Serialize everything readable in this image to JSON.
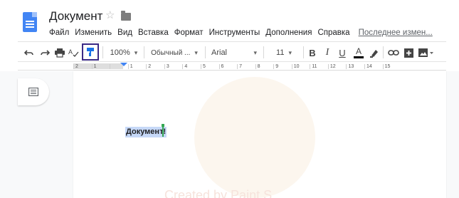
{
  "document": {
    "title": "Документ",
    "body_text": "Документ!"
  },
  "menu": {
    "items": [
      "Файл",
      "Изменить",
      "Вид",
      "Вставка",
      "Формат",
      "Инструменты",
      "Дополнения",
      "Справка"
    ],
    "last_edit": "Последнее измен..."
  },
  "toolbar": {
    "zoom": "100%",
    "style": "Обычный ...",
    "font": "Arial",
    "font_size": "11",
    "icons": [
      "undo-icon",
      "redo-icon",
      "print-icon",
      "spellcheck-icon",
      "paint-format-icon",
      "bold-icon",
      "italic-icon",
      "underline-icon",
      "text-color-icon",
      "highlight-icon",
      "link-icon",
      "comment-icon",
      "image-icon"
    ]
  },
  "ruler": {
    "labels": [
      "2",
      "1",
      "",
      "1",
      "2",
      "3",
      "4",
      "5",
      "6",
      "7",
      "8",
      "9",
      "10",
      "11",
      "12",
      "13",
      "14",
      "15"
    ]
  },
  "watermark": {
    "text": "Created by Paint S"
  },
  "colors": {
    "brand": "#4285f4",
    "selection": "#c6d8f7",
    "cursor": "#34a853",
    "highlight_box": "#3b2a86",
    "text_color_bar": "#000000"
  }
}
